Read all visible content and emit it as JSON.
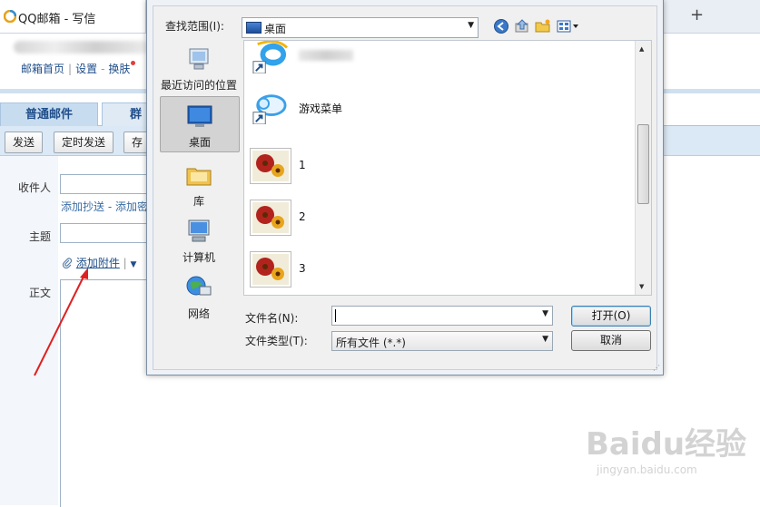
{
  "browser": {
    "tab_title": "QQ邮箱 - 写信",
    "new_tab": "+"
  },
  "mail": {
    "top_links": [
      "邮箱首页",
      "设置",
      "换肤"
    ],
    "tabs": [
      "普通邮件",
      "群"
    ],
    "toolbar": [
      "发送",
      "定时发送",
      "存"
    ],
    "recipients_label": "收件人",
    "cc_bcc": "添加抄送 - 添加密",
    "subject_label": "主题",
    "attach_label": "添加附件",
    "body_label": "正文"
  },
  "dialog": {
    "lookin_label": "查找范围(I):",
    "lookin_value": "桌面",
    "places": [
      {
        "label": "最近访问的位置",
        "icon": "recent-places-icon"
      },
      {
        "label": "桌面",
        "icon": "desktop-icon"
      },
      {
        "label": "库",
        "icon": "library-icon"
      },
      {
        "label": "计算机",
        "icon": "computer-icon"
      },
      {
        "label": "网络",
        "icon": "network-icon"
      }
    ],
    "files": [
      {
        "name": "",
        "icon": "ie-shortcut-icon"
      },
      {
        "name": "游戏菜单",
        "icon": "game-menu-shortcut-icon"
      },
      {
        "name": "1",
        "icon": "flower-image-icon"
      },
      {
        "name": "2",
        "icon": "flower-image-icon"
      },
      {
        "name": "3",
        "icon": "flower-image-icon"
      }
    ],
    "filename_label": "文件名(N):",
    "filename_value": "",
    "filetype_label": "文件类型(T):",
    "filetype_value": "所有文件 (*.*)",
    "open_button": "打开(O)",
    "cancel_button": "取消"
  },
  "watermark": {
    "brand": "Baidu经验",
    "url": "jingyan.baidu.com"
  },
  "colors": {
    "accent_blue": "#1f4e8a",
    "toolbar_bg": "#dbe8f5",
    "annotation_red": "#e02020"
  }
}
